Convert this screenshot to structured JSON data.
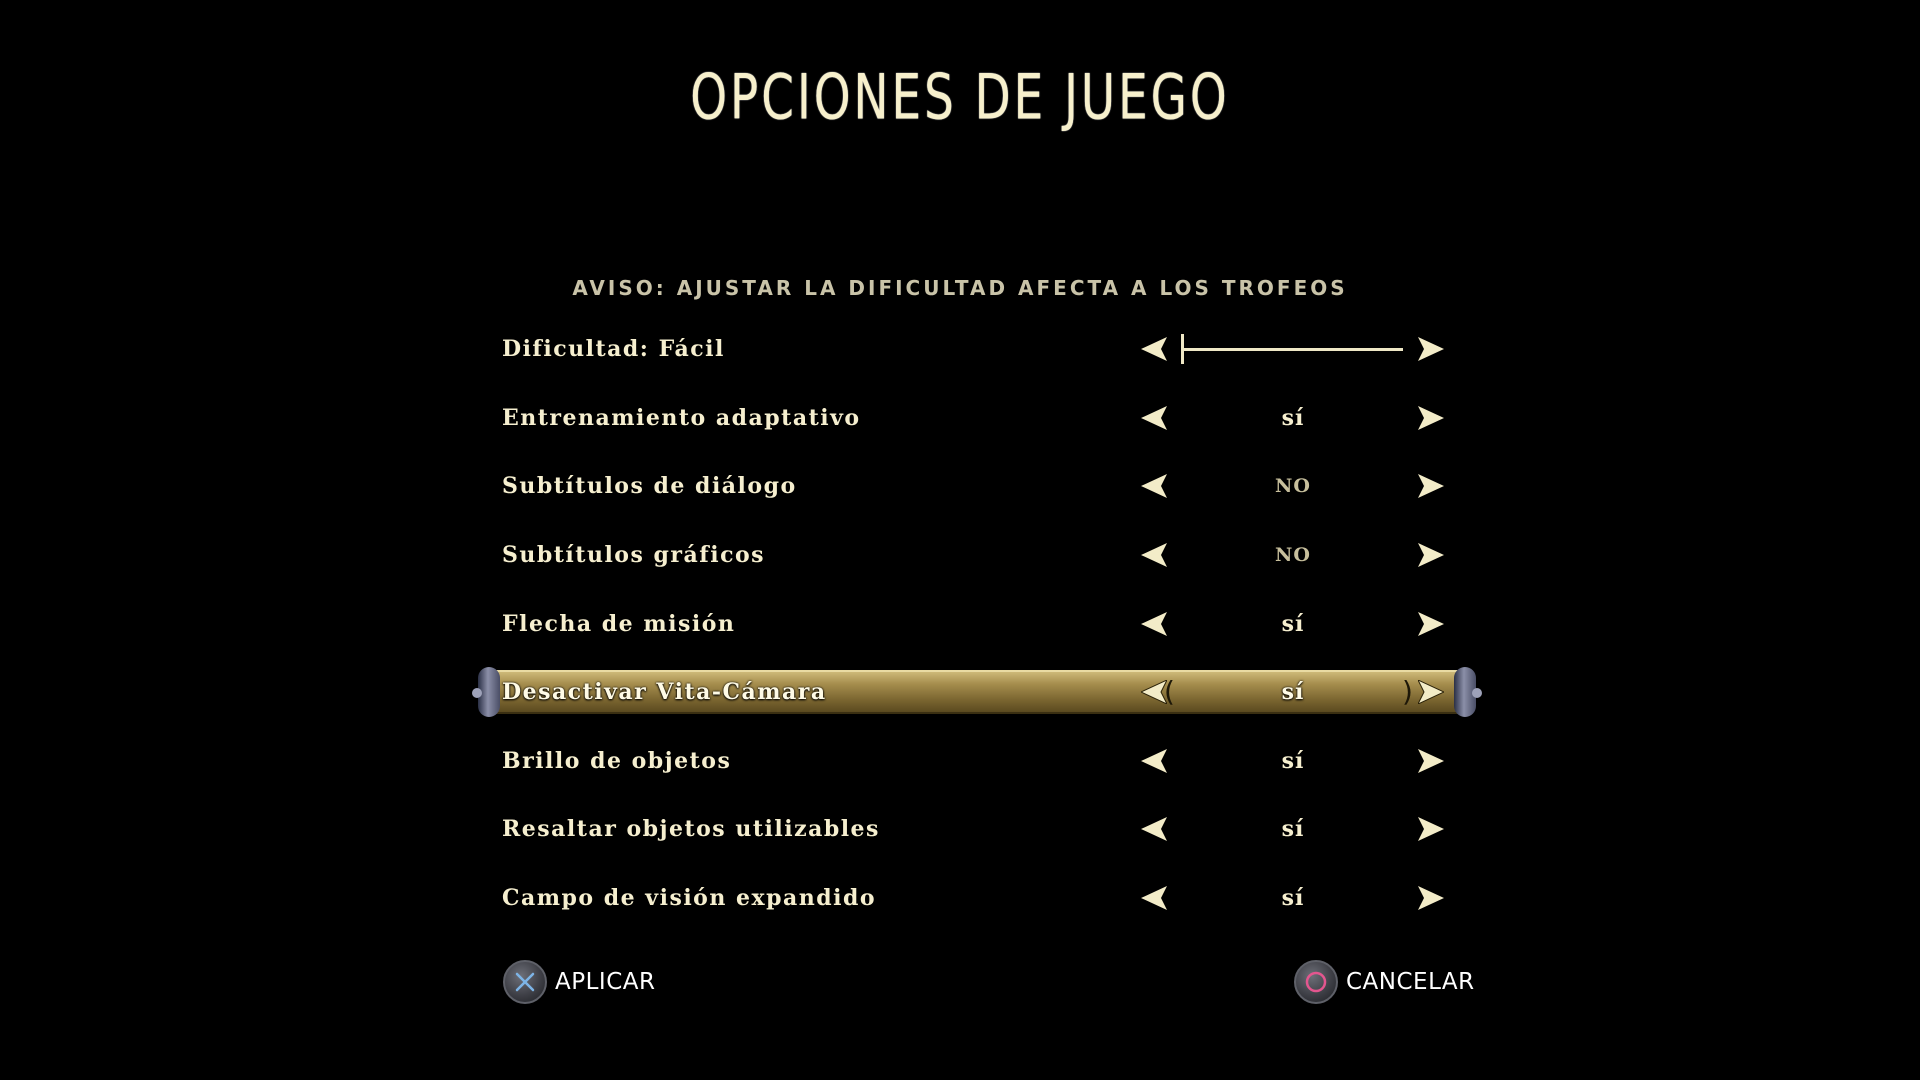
{
  "screen": {
    "title": "OPCIONES DE JUEGO",
    "notice": "AVISO: AJUSTAR LA DIFICULTAD AFECTA A LOS TROFEOS"
  },
  "options": [
    {
      "label": "Dificultad: Fácil",
      "type": "slider",
      "level": 0
    },
    {
      "label": "Entrenamiento adaptativo",
      "value": "sí"
    },
    {
      "label": "Subtítulos de diálogo",
      "value": "NO"
    },
    {
      "label": "Subtítulos gráficos",
      "value": "NO"
    },
    {
      "label": "Flecha de misión",
      "value": "sí"
    },
    {
      "label": "Desactivar Vita-Cámara",
      "value": "sí",
      "selected": true
    },
    {
      "label": "Brillo de objetos",
      "value": "sí"
    },
    {
      "label": "Resaltar objetos utilizables",
      "value": "sí"
    },
    {
      "label": "Campo de visión expandido",
      "value": "sí"
    }
  ],
  "footer": {
    "apply": {
      "label": "APLICAR",
      "icon": "cross-button-icon",
      "color": "#6fa8dc"
    },
    "cancel": {
      "label": "CANCELAR",
      "icon": "circle-button-icon",
      "color": "#e0508a"
    }
  },
  "colors": {
    "background": "#000000",
    "text": "#f6efcf",
    "highlight": "#a58d4d"
  }
}
